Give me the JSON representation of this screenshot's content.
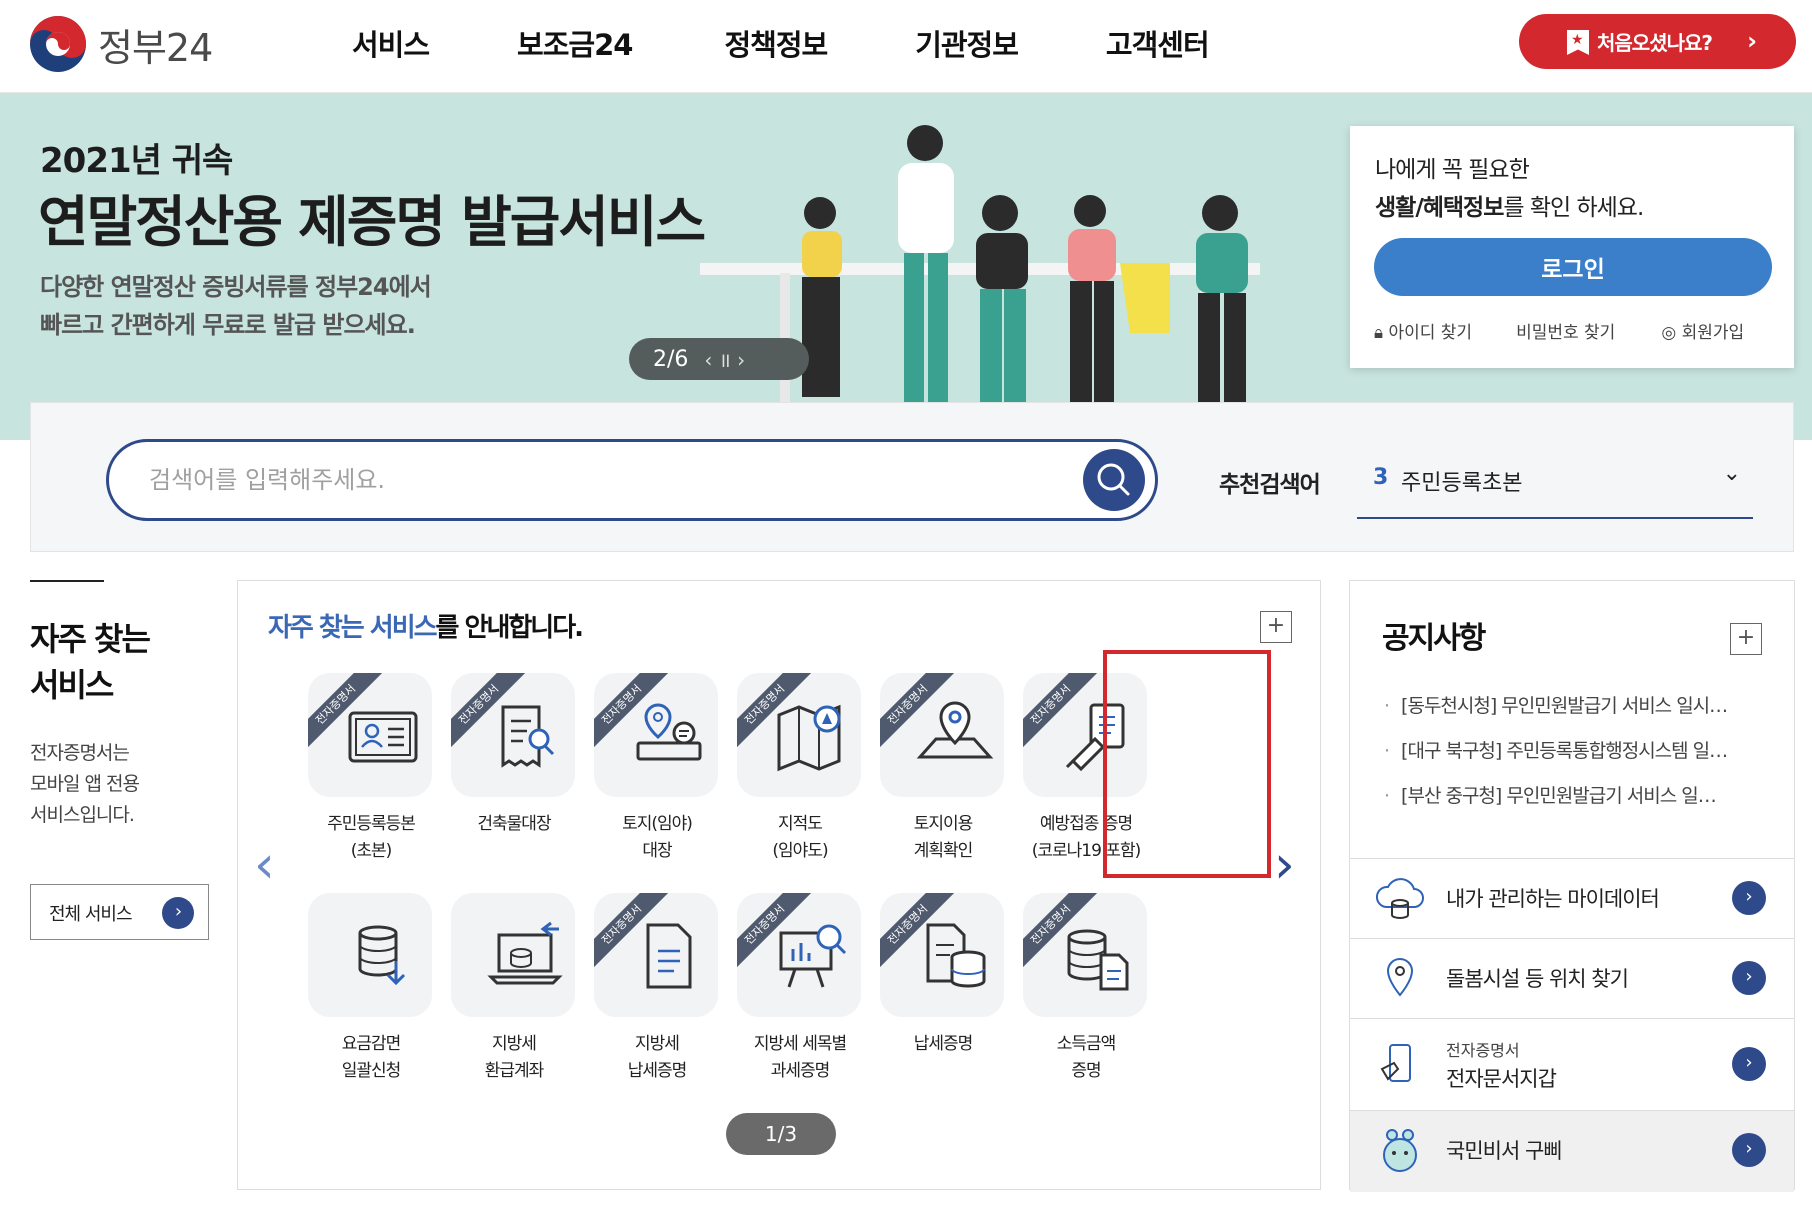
{
  "header": {
    "logo_text": "정부24",
    "nav": [
      "서비스",
      "보조금24",
      "정책정보",
      "기관정보",
      "고객센터"
    ],
    "first_visit_label": "처음오셨나요?",
    "first_visit_chevron": "›"
  },
  "hero": {
    "subtitle": "2021년 귀속",
    "title": "연말정산용 제증명 발급서비스",
    "desc_line1": "다양한 연말정산 증빙서류를 정부24에서",
    "desc_line2": "빠르고 간편하게 무료로 발급 받으세요.",
    "pager": "2/6",
    "pager_controls": "‹  ॥  ›"
  },
  "login": {
    "line1": "나에게 꼭 필요한",
    "line2_bold": "생활/혜택정보",
    "line2_rest": "를 확인 하세요.",
    "button": "로그인",
    "find_id": "아이디 찾기",
    "find_pw": "비밀번호 찾기",
    "signup": "회원가입"
  },
  "search": {
    "placeholder": "검색어를 입력해주세요.",
    "recommend_label": "추천검색어",
    "recommend_num": "3",
    "recommend_text": "주민등록초본"
  },
  "frequent": {
    "title_line1": "자주 찾는",
    "title_line2": "서비스",
    "desc_line1": "전자증명서는",
    "desc_line2": "모바일 앱 전용",
    "desc_line3": "서비스입니다.",
    "all_button": "전체 서비스"
  },
  "services": {
    "heading_highlight": "자주 찾는 서비스",
    "heading_rest": "를 안내합니다.",
    "ribbon": "전자증명서",
    "pager": "1/3",
    "items": [
      {
        "line1": "주민등록등본",
        "line2": "(초본)",
        "ribbon": true,
        "icon": "id-card-icon"
      },
      {
        "line1": "건축물대장",
        "line2": "",
        "ribbon": true,
        "icon": "document-search-icon"
      },
      {
        "line1": "토지(임야)",
        "line2": "대장",
        "ribbon": true,
        "icon": "land-pin-icon"
      },
      {
        "line1": "지적도",
        "line2": "(임야도)",
        "ribbon": true,
        "icon": "map-compass-icon"
      },
      {
        "line1": "토지이용",
        "line2": "계획확인",
        "ribbon": true,
        "icon": "map-pin-icon"
      },
      {
        "line1": "예방접종 증명",
        "line2": "(코로나19 포함)",
        "ribbon": true,
        "icon": "vaccine-document-icon"
      },
      {
        "line1": "요금감면",
        "line2": "일괄신청",
        "ribbon": false,
        "icon": "database-download-icon"
      },
      {
        "line1": "지방세",
        "line2": "환급계좌",
        "ribbon": false,
        "icon": "laptop-refund-icon"
      },
      {
        "line1": "지방세",
        "line2": "납세증명",
        "ribbon": true,
        "icon": "tax-document-icon"
      },
      {
        "line1": "지방세 세목별",
        "line2": "과세증명",
        "ribbon": true,
        "icon": "chart-board-icon"
      },
      {
        "line1": "납세증명",
        "line2": "",
        "ribbon": true,
        "icon": "document-database-icon"
      },
      {
        "line1": "소득금액",
        "line2": "증명",
        "ribbon": true,
        "icon": "database-document-icon"
      }
    ]
  },
  "notice": {
    "title": "공지사항",
    "items": [
      "[동두천시청] 무인민원발급기 서비스 일시…",
      "[대구 북구청] 주민등록통합행정시스템 일…",
      "[부산 중구청] 무인민원발급기 서비스 일…"
    ],
    "quick": {
      "mydata": "내가 관리하는 마이데이터",
      "care": "돌봄시설 등 위치 찾기",
      "wallet_sub": "전자증명서",
      "wallet": "전자문서지갑",
      "gubbi": "국민비서 구삐"
    }
  },
  "colors": {
    "accent_navy": "#2e4a8a",
    "brand_red": "#d2282e",
    "hero_bg": "#c7e4de",
    "login_blue": "#3b7fca"
  }
}
